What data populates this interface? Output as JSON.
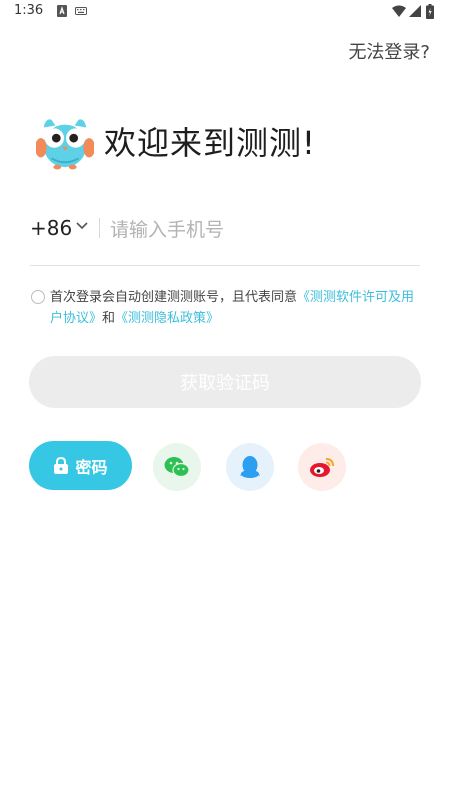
{
  "status_bar": {
    "time": "1:36"
  },
  "header": {
    "help_link": "无法登录?"
  },
  "welcome": {
    "title": "欢迎来到测测!"
  },
  "phone": {
    "country_code": "+86",
    "placeholder": "请输入手机号",
    "value": ""
  },
  "agreement": {
    "text_prefix": "首次登录会自动创建测测账号，且代表同意",
    "link_terms": "《测测软件许可及用户协议》",
    "connector": "和",
    "link_privacy": "《测测隐私政策》"
  },
  "actions": {
    "get_code_label": "获取验证码",
    "password_label": "密码"
  },
  "colors": {
    "accent": "#35c7e4",
    "link": "#3cbfdb",
    "disabled_button": "#ececec"
  },
  "icons": [
    "lock-icon",
    "wechat-icon",
    "qq-icon",
    "weibo-icon",
    "owl-logo"
  ]
}
